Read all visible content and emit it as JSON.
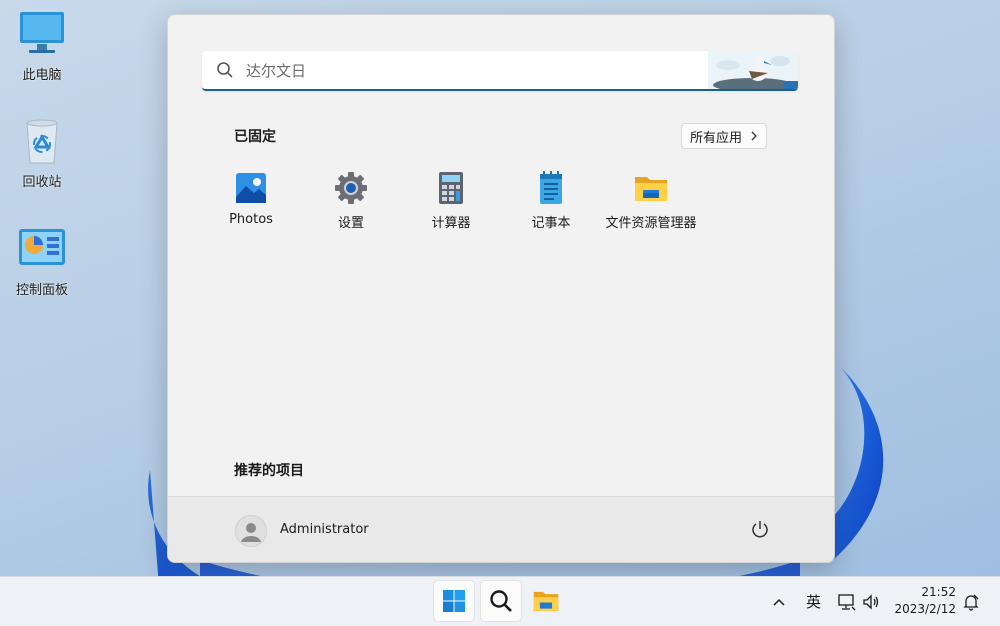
{
  "desktop": {
    "icons": [
      {
        "label": "此电脑",
        "icon": "computer-icon"
      },
      {
        "label": "回收站",
        "icon": "recycle-bin-icon"
      },
      {
        "label": "控制面板",
        "icon": "control-panel-icon"
      }
    ]
  },
  "start_menu": {
    "search": {
      "placeholder": "达尔文日"
    },
    "pinned": {
      "title": "已固定",
      "all_apps_label": "所有应用",
      "apps": [
        {
          "label": "Photos",
          "icon": "photos-icon"
        },
        {
          "label": "设置",
          "icon": "settings-gear-icon"
        },
        {
          "label": "计算器",
          "icon": "calculator-icon"
        },
        {
          "label": "记事本",
          "icon": "notepad-icon"
        },
        {
          "label": "文件资源管理器",
          "icon": "file-explorer-icon"
        }
      ]
    },
    "recommended": {
      "title": "推荐的项目"
    },
    "user": {
      "name": "Administrator"
    }
  },
  "taskbar": {
    "buttons": [
      "start-icon",
      "search-icon",
      "file-explorer-icon"
    ],
    "tray": {
      "ime": "英",
      "time": "21:52",
      "date": "2023/2/12"
    }
  },
  "colors": {
    "accent": "#1f6087",
    "wallpaper_blue": "#1d5fd8"
  }
}
